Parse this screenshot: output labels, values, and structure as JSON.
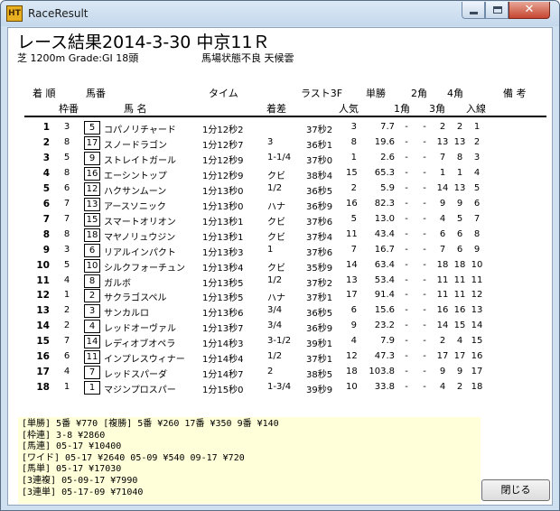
{
  "window": {
    "app_icon_text": "HT",
    "title": "RaceResult",
    "close_glyph": "✕"
  },
  "race": {
    "title": "レース結果2014-3-30 中京11Ｒ",
    "info": "芝 1200m Grade:GⅠ  18頭",
    "condition": "馬場状態不良  天候雲"
  },
  "headers": {
    "chakujun": "着 順",
    "umaban": "馬番",
    "time": "タイム",
    "last3f": "ラスト3F",
    "tansho": "単勝",
    "corner2": "2角",
    "corner4": "4角",
    "biko": "備 考",
    "wakuban": "枠番",
    "bamei": "馬 名",
    "chakusa": "着差",
    "ninki": "人気",
    "corner1": "1角",
    "corner3": "3角",
    "nyusen": "入線"
  },
  "results": [
    {
      "pos": "1",
      "waku": "3",
      "num": "5",
      "name": "コパノリチャード",
      "time": "1分12秒2",
      "margin": "",
      "l3f": "37秒2",
      "pop": "3",
      "odds": "7.7",
      "p1": "-",
      "p2": "-",
      "p3": "2",
      "p4": "2",
      "fin": "1"
    },
    {
      "pos": "2",
      "waku": "8",
      "num": "17",
      "name": "スノードラゴン",
      "time": "1分12秒7",
      "margin": "3",
      "l3f": "36秒1",
      "pop": "8",
      "odds": "19.6",
      "p1": "-",
      "p2": "-",
      "p3": "13",
      "p4": "13",
      "fin": "2"
    },
    {
      "pos": "3",
      "waku": "5",
      "num": "9",
      "name": "ストレイトガール",
      "time": "1分12秒9",
      "margin": "1-1/4",
      "l3f": "37秒0",
      "pop": "1",
      "odds": "2.6",
      "p1": "-",
      "p2": "-",
      "p3": "7",
      "p4": "8",
      "fin": "3"
    },
    {
      "pos": "4",
      "waku": "8",
      "num": "16",
      "name": "エーシントップ",
      "time": "1分12秒9",
      "margin": "クビ",
      "l3f": "38秒4",
      "pop": "15",
      "odds": "65.3",
      "p1": "-",
      "p2": "-",
      "p3": "1",
      "p4": "1",
      "fin": "4"
    },
    {
      "pos": "5",
      "waku": "6",
      "num": "12",
      "name": "ハクサンムーン",
      "time": "1分13秒0",
      "margin": "1/2",
      "l3f": "36秒5",
      "pop": "2",
      "odds": "5.9",
      "p1": "-",
      "p2": "-",
      "p3": "14",
      "p4": "13",
      "fin": "5"
    },
    {
      "pos": "6",
      "waku": "7",
      "num": "13",
      "name": "アースソニック",
      "time": "1分13秒0",
      "margin": "ハナ",
      "l3f": "36秒9",
      "pop": "16",
      "odds": "82.3",
      "p1": "-",
      "p2": "-",
      "p3": "9",
      "p4": "9",
      "fin": "6"
    },
    {
      "pos": "7",
      "waku": "7",
      "num": "15",
      "name": "スマートオリオン",
      "time": "1分13秒1",
      "margin": "クビ",
      "l3f": "37秒6",
      "pop": "5",
      "odds": "13.0",
      "p1": "-",
      "p2": "-",
      "p3": "4",
      "p4": "5",
      "fin": "7"
    },
    {
      "pos": "8",
      "waku": "8",
      "num": "18",
      "name": "マヤノリュウジン",
      "time": "1分13秒1",
      "margin": "クビ",
      "l3f": "37秒4",
      "pop": "11",
      "odds": "43.4",
      "p1": "-",
      "p2": "-",
      "p3": "6",
      "p4": "6",
      "fin": "8"
    },
    {
      "pos": "9",
      "waku": "3",
      "num": "6",
      "name": "リアルインパクト",
      "time": "1分13秒3",
      "margin": "1",
      "l3f": "37秒6",
      "pop": "7",
      "odds": "16.7",
      "p1": "-",
      "p2": "-",
      "p3": "7",
      "p4": "6",
      "fin": "9"
    },
    {
      "pos": "10",
      "waku": "5",
      "num": "10",
      "name": "シルクフォーチュン",
      "time": "1分13秒4",
      "margin": "クビ",
      "l3f": "35秒9",
      "pop": "14",
      "odds": "63.4",
      "p1": "-",
      "p2": "-",
      "p3": "18",
      "p4": "18",
      "fin": "10"
    },
    {
      "pos": "11",
      "waku": "4",
      "num": "8",
      "name": "ガルボ",
      "time": "1分13秒5",
      "margin": "1/2",
      "l3f": "37秒2",
      "pop": "13",
      "odds": "53.4",
      "p1": "-",
      "p2": "-",
      "p3": "11",
      "p4": "11",
      "fin": "11"
    },
    {
      "pos": "12",
      "waku": "1",
      "num": "2",
      "name": "サクラゴスペル",
      "time": "1分13秒5",
      "margin": "ハナ",
      "l3f": "37秒1",
      "pop": "17",
      "odds": "91.4",
      "p1": "-",
      "p2": "-",
      "p3": "11",
      "p4": "11",
      "fin": "12"
    },
    {
      "pos": "13",
      "waku": "2",
      "num": "3",
      "name": "サンカルロ",
      "time": "1分13秒6",
      "margin": "3/4",
      "l3f": "36秒5",
      "pop": "6",
      "odds": "15.6",
      "p1": "-",
      "p2": "-",
      "p3": "16",
      "p4": "16",
      "fin": "13"
    },
    {
      "pos": "14",
      "waku": "2",
      "num": "4",
      "name": "レッドオーヴァル",
      "time": "1分13秒7",
      "margin": "3/4",
      "l3f": "36秒9",
      "pop": "9",
      "odds": "23.2",
      "p1": "-",
      "p2": "-",
      "p3": "14",
      "p4": "15",
      "fin": "14"
    },
    {
      "pos": "15",
      "waku": "7",
      "num": "14",
      "name": "レディオブオペラ",
      "time": "1分14秒3",
      "margin": "3-1/2",
      "l3f": "39秒1",
      "pop": "4",
      "odds": "7.9",
      "p1": "-",
      "p2": "-",
      "p3": "2",
      "p4": "4",
      "fin": "15"
    },
    {
      "pos": "16",
      "waku": "6",
      "num": "11",
      "name": "インプレスウィナー",
      "time": "1分14秒4",
      "margin": "1/2",
      "l3f": "37秒1",
      "pop": "12",
      "odds": "47.3",
      "p1": "-",
      "p2": "-",
      "p3": "17",
      "p4": "17",
      "fin": "16"
    },
    {
      "pos": "17",
      "waku": "4",
      "num": "7",
      "name": "レッドスパーダ",
      "time": "1分14秒7",
      "margin": "2",
      "l3f": "38秒5",
      "pop": "18",
      "odds": "103.8",
      "p1": "-",
      "p2": "-",
      "p3": "9",
      "p4": "9",
      "fin": "17"
    },
    {
      "pos": "18",
      "waku": "1",
      "num": "1",
      "name": "マジンプロスパー",
      "time": "1分15秒0",
      "margin": "1-3/4",
      "l3f": "39秒9",
      "pop": "10",
      "odds": "33.8",
      "p1": "-",
      "p2": "-",
      "p3": "4",
      "p4": "2",
      "fin": "18"
    }
  ],
  "payouts": [
    "[単勝] 5番 ¥770    [複勝] 5番 ¥260   17番 ¥350   9番 ¥140",
    "[枠連] 3-8 ¥2860",
    "[馬連] 05-17 ¥10400",
    "[ワイド] 05-17 ¥2640   05-09 ¥540   09-17 ¥720",
    "[馬単] 05-17 ¥17030",
    "[3連複] 05-09-17 ¥7990",
    "[3連単] 05-17-09 ¥71040"
  ],
  "buttons": {
    "close_label": "閉じる"
  }
}
